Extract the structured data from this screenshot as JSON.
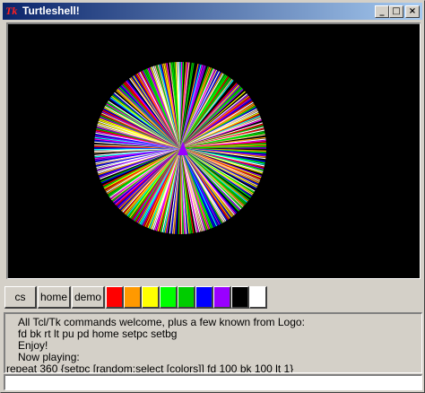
{
  "window": {
    "title": "Turtleshell!",
    "app_icon": "tk-feather-icon",
    "app_icon_text": "Tk",
    "controls": {
      "minimize": "_",
      "maximize": "□",
      "close": "×"
    }
  },
  "canvas": {
    "background": "#000000",
    "turtle_color": "#9900ff"
  },
  "toolbar": {
    "cs_label": "cs",
    "home_label": "home",
    "demo_label": "demo",
    "colors": [
      "#ff0000",
      "#ff9900",
      "#ffff00",
      "#00ff00",
      "#00cc00",
      "#0000ff",
      "#9900ff",
      "#000000",
      "#ffffff"
    ]
  },
  "console": {
    "lines": [
      "All Tcl/Tk commands welcome, plus a few known from Logo:",
      "fd bk rt lt pu pd home setpc setbg",
      "Enjoy!",
      "Now playing:",
      "repeat 360 {setpc [random:select [colors]] fd 100 bk 100 lt 1}"
    ]
  },
  "input": {
    "value": ""
  }
}
